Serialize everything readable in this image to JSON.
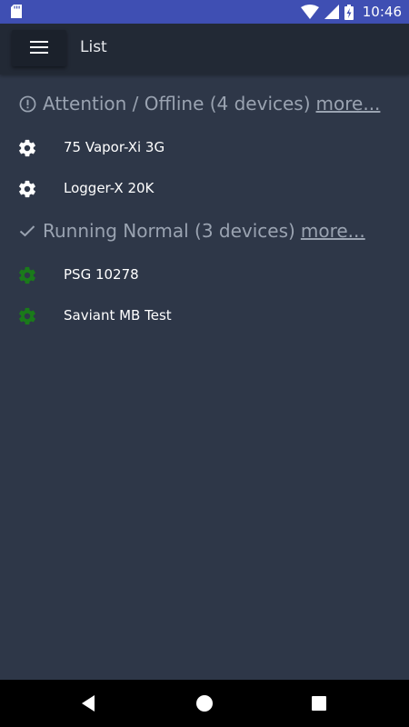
{
  "status_bar": {
    "time": "10:46",
    "icons": [
      "sd-card-icon",
      "wifi-icon",
      "signal-icon",
      "battery-charging-icon"
    ]
  },
  "app_bar": {
    "menu_icon": "hamburger-menu-icon",
    "title": "List"
  },
  "sections": [
    {
      "icon": "alert-circle-icon",
      "title": "Attention / Offline (4 devices)",
      "more_label": "more...",
      "devices": [
        {
          "name": "75 Vapor-Xi 3G",
          "icon": "gear-icon",
          "color": "#ffffff"
        },
        {
          "name": "Logger-X 20K",
          "icon": "gear-icon",
          "color": "#ffffff"
        }
      ]
    },
    {
      "icon": "check-icon",
      "title": "Running Normal (3 devices)",
      "more_label": "more...",
      "devices": [
        {
          "name": "PSG 10278",
          "icon": "gear-icon",
          "color": "#1a7a1a"
        },
        {
          "name": "Saviant MB Test",
          "icon": "gear-icon",
          "color": "#1a7a1a"
        }
      ]
    }
  ],
  "nav_bar": {
    "icons": [
      "back-icon",
      "home-icon",
      "recents-icon"
    ]
  },
  "colors": {
    "status_bar": "#3f4fb3",
    "app_bar": "#222935",
    "background": "#2e3748",
    "header_text": "#9aa3b1",
    "ok_green": "#1a7a1a"
  }
}
